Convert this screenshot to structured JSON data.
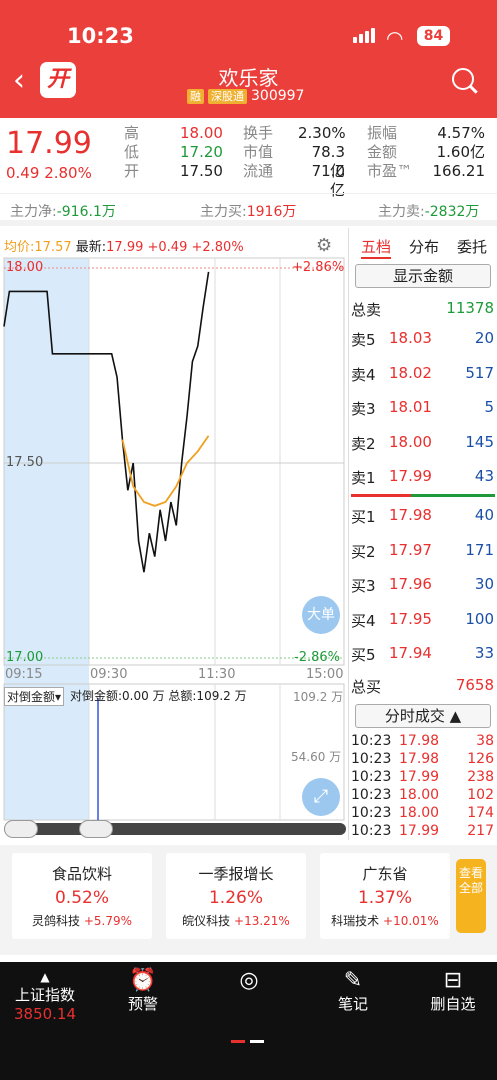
{
  "status": {
    "time": "10:23",
    "battery": "84"
  },
  "header": {
    "back_icon": "back-arrow-icon",
    "logo_text": "开",
    "title": "欢乐家",
    "tag_margin": "融",
    "tag_connect": "深股通",
    "code": "300997"
  },
  "quote": {
    "price": "17.99",
    "change": "0.49",
    "change_pct": "2.80%",
    "cols": [
      {
        "labels": [
          "高",
          "低",
          "开"
        ],
        "values": [
          "18.00",
          "17.20",
          "17.50"
        ],
        "colors": [
          "#e8302f",
          "#1f9a3a",
          "#222"
        ]
      },
      {
        "labels": [
          "换手",
          "市值",
          "流通"
        ],
        "values": [
          "2.30%",
          "78.3亿",
          "71.0亿"
        ]
      },
      {
        "labels": [
          "振幅",
          "金额",
          "市盈™"
        ],
        "values": [
          "4.57%",
          "1.60亿",
          "166.21"
        ]
      }
    ]
  },
  "money_flow": {
    "net_label": "主力净:",
    "net_value": "-916.1万",
    "buy_label": "主力买:",
    "buy_value": "1916万",
    "sell_label": "主力卖:",
    "sell_value": "-2832万"
  },
  "chart": {
    "avg_label": "均价:",
    "avg": "17.57",
    "latest_label": "最新:",
    "latest": "17.99",
    "latest_chg": "+0.49",
    "latest_pct": "+2.80%",
    "y_top": "18.00",
    "y_mid": "17.50",
    "y_bot": "17.00",
    "pct_top": "+2.86%",
    "pct_bot": "-2.86%",
    "x_labels": [
      "09:15",
      "09:30",
      "11:30",
      "15:00"
    ],
    "big_order": "大单",
    "sub_select": "对倒金额",
    "sub_info": "对倒金额:0.00 万 总额:109.2 万",
    "sub_top": "109.2 万",
    "sub_mid": "54.60 万"
  },
  "chart_data": {
    "type": "line",
    "title": "",
    "x_axis": [
      "09:15",
      "09:30",
      "11:30",
      "15:00"
    ],
    "ylim": [
      17.0,
      18.0
    ],
    "prev_close": 17.5,
    "series": [
      {
        "name": "最新",
        "color": "#111",
        "points": [
          [
            0,
            17.85
          ],
          [
            0.5,
            17.94
          ],
          [
            4,
            17.94
          ],
          [
            4.5,
            17.78
          ],
          [
            10,
            17.78
          ],
          [
            10.5,
            17.72
          ],
          [
            11,
            17.56
          ],
          [
            11.5,
            17.43
          ],
          [
            12,
            17.5
          ],
          [
            12.5,
            17.3
          ],
          [
            13,
            17.22
          ],
          [
            13.5,
            17.32
          ],
          [
            14,
            17.26
          ],
          [
            14.5,
            17.38
          ],
          [
            15,
            17.3
          ],
          [
            15.5,
            17.4
          ],
          [
            16,
            17.34
          ],
          [
            16.5,
            17.5
          ],
          [
            17,
            17.62
          ],
          [
            17.5,
            17.76
          ],
          [
            18,
            17.8
          ],
          [
            18.5,
            17.9
          ],
          [
            19,
            17.99
          ]
        ]
      },
      {
        "name": "均价",
        "color": "#f0a020",
        "points": [
          [
            11,
            17.56
          ],
          [
            12,
            17.44
          ],
          [
            13,
            17.4
          ],
          [
            14,
            17.39
          ],
          [
            15,
            17.4
          ],
          [
            16,
            17.44
          ],
          [
            17,
            17.5
          ],
          [
            18,
            17.53
          ],
          [
            19,
            17.57
          ]
        ]
      }
    ]
  },
  "orderbook": {
    "tabs": [
      "五档",
      "分布",
      "委托"
    ],
    "show_amount": "显示金额",
    "total_sell_label": "总卖",
    "total_sell": "11378",
    "asks": [
      {
        "l": "卖5",
        "p": "18.03",
        "v": "20"
      },
      {
        "l": "卖4",
        "p": "18.02",
        "v": "517"
      },
      {
        "l": "卖3",
        "p": "18.01",
        "v": "5"
      },
      {
        "l": "卖2",
        "p": "18.00",
        "v": "145"
      },
      {
        "l": "卖1",
        "p": "17.99",
        "v": "43"
      }
    ],
    "bids": [
      {
        "l": "买1",
        "p": "17.98",
        "v": "40"
      },
      {
        "l": "买2",
        "p": "17.97",
        "v": "171"
      },
      {
        "l": "买3",
        "p": "17.96",
        "v": "30"
      },
      {
        "l": "买4",
        "p": "17.95",
        "v": "100"
      },
      {
        "l": "买5",
        "p": "17.94",
        "v": "33"
      }
    ],
    "total_buy_label": "总买",
    "total_buy": "7658",
    "tick_label": "分时成交",
    "ticks": [
      {
        "t": "10:23",
        "p": "17.98",
        "v": "38"
      },
      {
        "t": "10:23",
        "p": "17.98",
        "v": "126"
      },
      {
        "t": "10:23",
        "p": "17.99",
        "v": "238"
      },
      {
        "t": "10:23",
        "p": "18.00",
        "v": "102"
      },
      {
        "t": "10:23",
        "p": "18.00",
        "v": "174"
      },
      {
        "t": "10:23",
        "p": "17.99",
        "v": "217"
      }
    ]
  },
  "sectors": [
    {
      "name": "食品饮料",
      "pct": "0.52%",
      "lead": "灵鸽科技",
      "lead_pct": "+5.79%"
    },
    {
      "name": "一季报增长",
      "pct": "1.26%",
      "lead": "皖仪科技",
      "lead_pct": "+13.21%"
    },
    {
      "name": "广东省",
      "pct": "1.37%",
      "lead": "科瑞技术",
      "lead_pct": "+10.01%"
    }
  ],
  "view_all": "查看全部",
  "nav": {
    "index_name": "上证指数",
    "index_value": "3850.14",
    "items": [
      "预警",
      "笔记",
      "删自选"
    ]
  }
}
